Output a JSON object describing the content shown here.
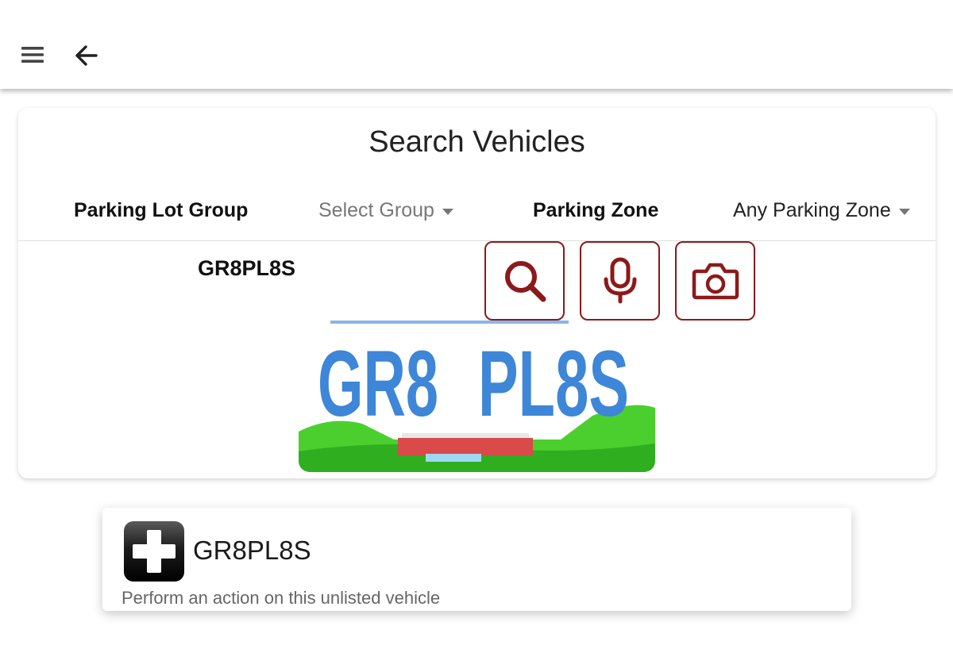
{
  "appbar": {
    "menu_icon": "hamburger-menu-icon",
    "back_icon": "arrow-left-icon"
  },
  "search": {
    "title": "Search Vehicles",
    "group_label": "Parking Lot Group",
    "group_value": "Select Group",
    "zone_label": "Parking Zone",
    "zone_value": "Any Parking Zone",
    "plate": "GR8PL8S",
    "buttons": {
      "search_icon": "search-icon",
      "mic_icon": "microphone-icon",
      "camera_icon": "camera-icon",
      "accent_color": "#8b1a1a"
    },
    "plate_image": {
      "text_left": "GR8",
      "text_right": "PL8S",
      "text_color": "#3d86d8"
    }
  },
  "result": {
    "icon": "add-plus-icon",
    "title": "GR8PL8S",
    "subtitle": "Perform an action on this unlisted vehicle"
  }
}
